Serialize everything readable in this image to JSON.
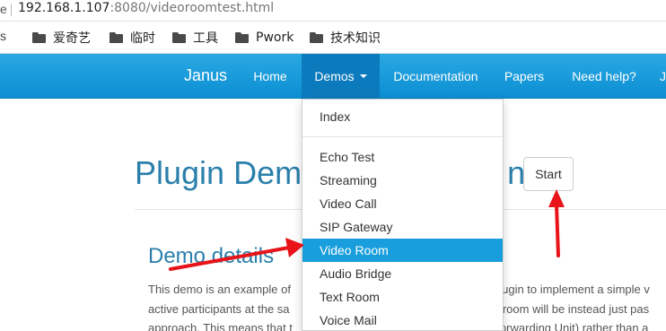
{
  "browser": {
    "address": {
      "lead": "e",
      "host": "192.168.1.107",
      "rest": ":8080/videoroomtest.html"
    },
    "bookmarks_lead": "s",
    "bookmarks": [
      "爱奇艺",
      "临时",
      "工具",
      "Pwork",
      "技术知识"
    ]
  },
  "navbar": {
    "brand": "Janus",
    "items": [
      "Home",
      "Demos",
      "Documentation",
      "Papers",
      "Need help?",
      "J"
    ],
    "active_item": "Demos"
  },
  "dropdown": {
    "index": "Index",
    "items": [
      "Echo Test",
      "Streaming",
      "Video Call",
      "SIP Gateway",
      "Video Room",
      "Audio Bridge",
      "Text Room",
      "Voice Mail"
    ],
    "highlighted": "Video Room"
  },
  "page": {
    "title_left": "Plugin Dem",
    "title_right": "n",
    "start_button": "Start",
    "details_heading": "Demo details",
    "lines_left": [
      "This demo is an example of",
      "active participants at the sa",
      "approach. This means that t"
    ],
    "lines_right": [
      "plugin to implement a simple v",
      "e room will be instead just pas",
      "Forwarding Unit) rather than a"
    ]
  },
  "colors": {
    "navbar": "#1a9ddb",
    "active_nav": "#0c7bbd",
    "dropdown_highlight": "#189edc",
    "heading": "#2a7fab",
    "annotation_arrow": "#e8141a"
  }
}
